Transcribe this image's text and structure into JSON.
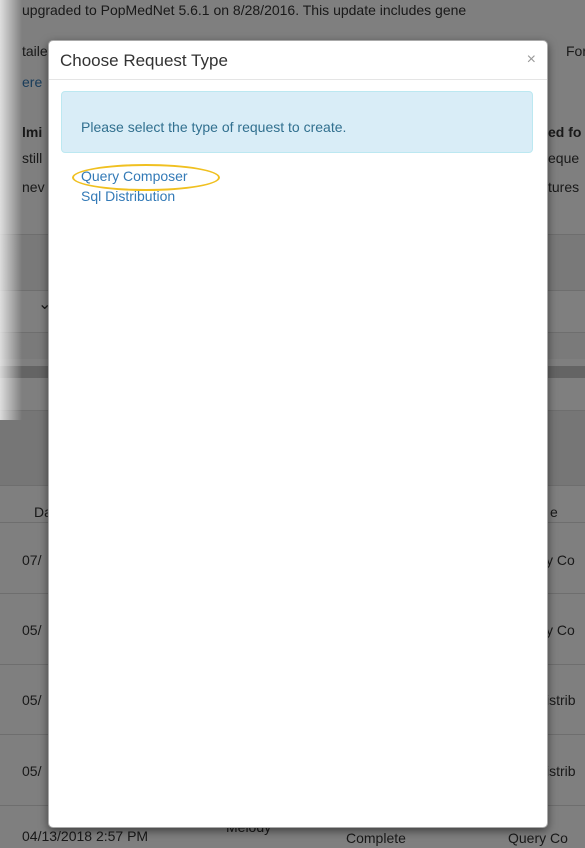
{
  "background": {
    "banner_line1": "upgraded to PopMedNet 5.6.1 on 8/28/2016. This update includes gene",
    "banner_line2_left": "taile",
    "banner_line2_right": "For",
    "banner_line3_left": "ere",
    "notice_line1_left": "lmi",
    "notice_line1_right": "ed fo",
    "notice_line2_left": "still",
    "notice_line2_right": "eque",
    "notice_line3_left": "nev",
    "notice_line3_right": "tures",
    "toolbar_chevron": "⌄",
    "table": {
      "header_left": "Da",
      "header_right": "e",
      "rows": [
        {
          "date": "07/",
          "type": "y Co"
        },
        {
          "date": "05/",
          "type": "y Co"
        },
        {
          "date": "05/",
          "type": "istrib"
        },
        {
          "date": "05/",
          "type": "istrib"
        }
      ],
      "last_row": {
        "date": "04/13/2018 2:57 PM",
        "name": "Melody",
        "status": "Complete",
        "type": "Query Co"
      }
    }
  },
  "modal": {
    "title": "Choose Request Type",
    "close": "×",
    "alert_text": "Please select the type of request to create.",
    "request_types": [
      "Query Composer",
      "Sql Distribution"
    ]
  },
  "colors": {
    "link": "#337ab7",
    "alert_bg": "#d9edf7",
    "alert_text": "#31708f",
    "highlight": "#f0c020"
  }
}
